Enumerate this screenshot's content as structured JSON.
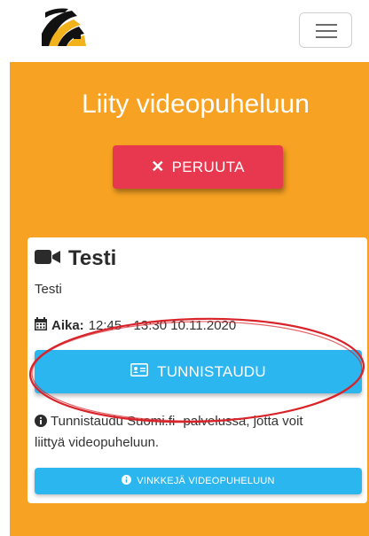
{
  "header": {
    "logo_icon": "brand-logo-icon",
    "menu_icon": "hamburger-menu-icon"
  },
  "hero": {
    "title": "Liity videopuheluun",
    "cancel_button": {
      "icon": "close-icon",
      "label": "PERUUTA"
    }
  },
  "card": {
    "icon": "video-camera-icon",
    "title": "Testi",
    "subtitle": "Testi",
    "time": {
      "icon": "calendar-icon",
      "label": "Aika:",
      "value": "12:45 - 13:30 10.11.2020"
    },
    "identify_button": {
      "icon": "id-card-icon",
      "label": "TUNNISTAUDU"
    },
    "info": {
      "icon": "info-circle-icon",
      "text": "Tunnistaudu Suomi.fi -palvelussa, jotta voit liittyä videopuheluun."
    },
    "tips_button": {
      "icon": "info-circle-icon",
      "label": "VINKKEJÄ VIDEOPUHELUUN"
    }
  },
  "colors": {
    "hero_bg": "#f7a222",
    "cancel_button": "#e8384f",
    "primary_button": "#2cb6ef",
    "highlight_annotation": "#d8232a"
  }
}
